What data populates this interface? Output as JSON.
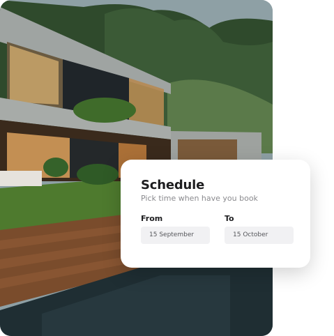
{
  "photo": {
    "alt": "Modern concrete villa with pool at dusk"
  },
  "card": {
    "title": "Schedule",
    "subtitle": "Pick time when have you book",
    "from": {
      "label": "From",
      "value": "15 September"
    },
    "to": {
      "label": "To",
      "value": "15 October"
    }
  },
  "colors": {
    "card_bg": "#ffffff",
    "field_bg": "#f1f1f3",
    "title": "#1d1d1f",
    "muted": "#8a8a8e"
  }
}
